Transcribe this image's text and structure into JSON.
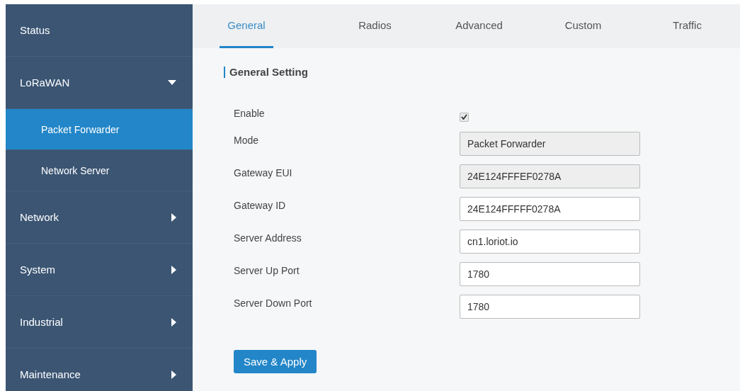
{
  "sidebar": {
    "items": [
      {
        "label": "Status",
        "selected": false
      },
      {
        "label": "LoRaWAN",
        "selected": false,
        "expanded": true,
        "children": [
          {
            "label": "Packet Forwarder",
            "selected": true
          },
          {
            "label": "Network Server",
            "selected": false
          }
        ]
      },
      {
        "label": "Network",
        "selected": false,
        "expanded": false
      },
      {
        "label": "System",
        "selected": false,
        "expanded": false
      },
      {
        "label": "Industrial",
        "selected": false,
        "expanded": false
      },
      {
        "label": "Maintenance",
        "selected": false,
        "expanded": false
      }
    ]
  },
  "tabs": [
    {
      "label": "General",
      "selected": true
    },
    {
      "label": "Radios",
      "selected": false
    },
    {
      "label": "Advanced",
      "selected": false
    },
    {
      "label": "Custom",
      "selected": false
    },
    {
      "label": "Traffic",
      "selected": false
    }
  ],
  "section": {
    "title": "General Setting"
  },
  "fields": [
    {
      "label": "Enable",
      "kind": "checkbox",
      "checked": true
    },
    {
      "label": "Mode",
      "kind": "text",
      "value": "Packet Forwarder",
      "disabled": true
    },
    {
      "label": "Gateway EUI",
      "kind": "text",
      "value": "24E124FFFEF0278A",
      "disabled": true
    },
    {
      "label": "Gateway ID",
      "kind": "text",
      "value": "24E124FFFFF0278A",
      "disabled": false
    },
    {
      "label": "Server Address",
      "kind": "text",
      "value": "cn1.loriot.io",
      "disabled": false
    },
    {
      "label": "Server Up Port",
      "kind": "text",
      "value": "1780",
      "disabled": false
    },
    {
      "label": "Server Down Port",
      "kind": "text",
      "value": "1780",
      "disabled": false
    }
  ],
  "save_button": "Save & Apply"
}
